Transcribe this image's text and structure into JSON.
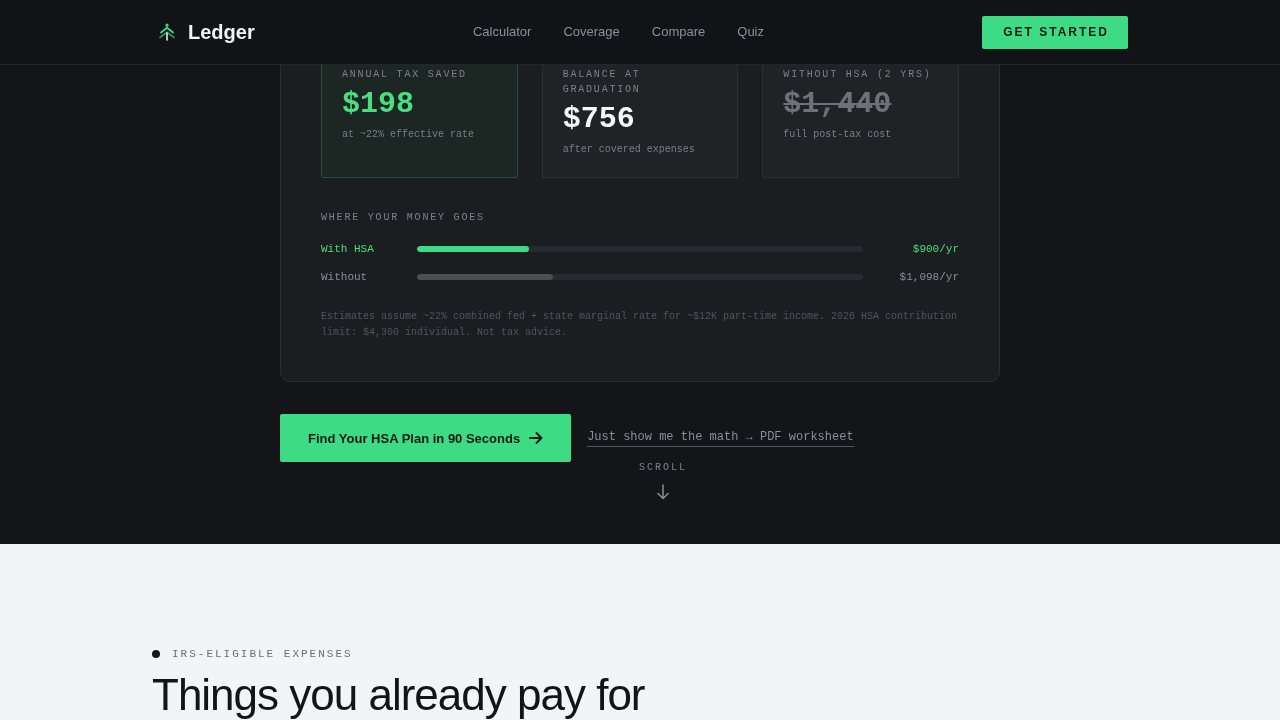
{
  "header": {
    "logo": "Ledger",
    "nav": [
      "Calculator",
      "Coverage",
      "Compare",
      "Quiz"
    ],
    "cta": "GET STARTED"
  },
  "results": {
    "stats": [
      {
        "label": "ANNUAL TAX SAVED",
        "value": "$198",
        "note": "at ~22% effective rate",
        "kind": "accent"
      },
      {
        "label": "BALANCE AT GRADUATION",
        "value": "$756",
        "note": "after covered expenses",
        "kind": "plain"
      },
      {
        "label": "WITHOUT HSA (2 YRS)",
        "value": "$1,440",
        "note": "full post-tax cost",
        "kind": "struck"
      }
    ],
    "breakdown": {
      "title": "WHERE YOUR MONEY GOES",
      "rows": [
        {
          "label": "With HSA",
          "level": 0.25,
          "value": "$900/yr",
          "highlighted": true
        },
        {
          "label": "Without",
          "level": 0.305,
          "value": "$1,098/yr",
          "highlighted": false
        }
      ]
    },
    "disclaimer": "Estimates assume ~22% combined fed + state marginal rate for ~$12K part-time income. 2026 HSA contribution limit: $4,300 individual. Not tax advice."
  },
  "actions": {
    "primary": "Find Your HSA Plan in 90 Seconds",
    "link": "Just show me the math → PDF worksheet"
  },
  "scroll_hint": "SCROLL",
  "next_section": {
    "eyebrow": "IRS-ELIGIBLE EXPENSES",
    "heading": "Things you already pay for"
  }
}
